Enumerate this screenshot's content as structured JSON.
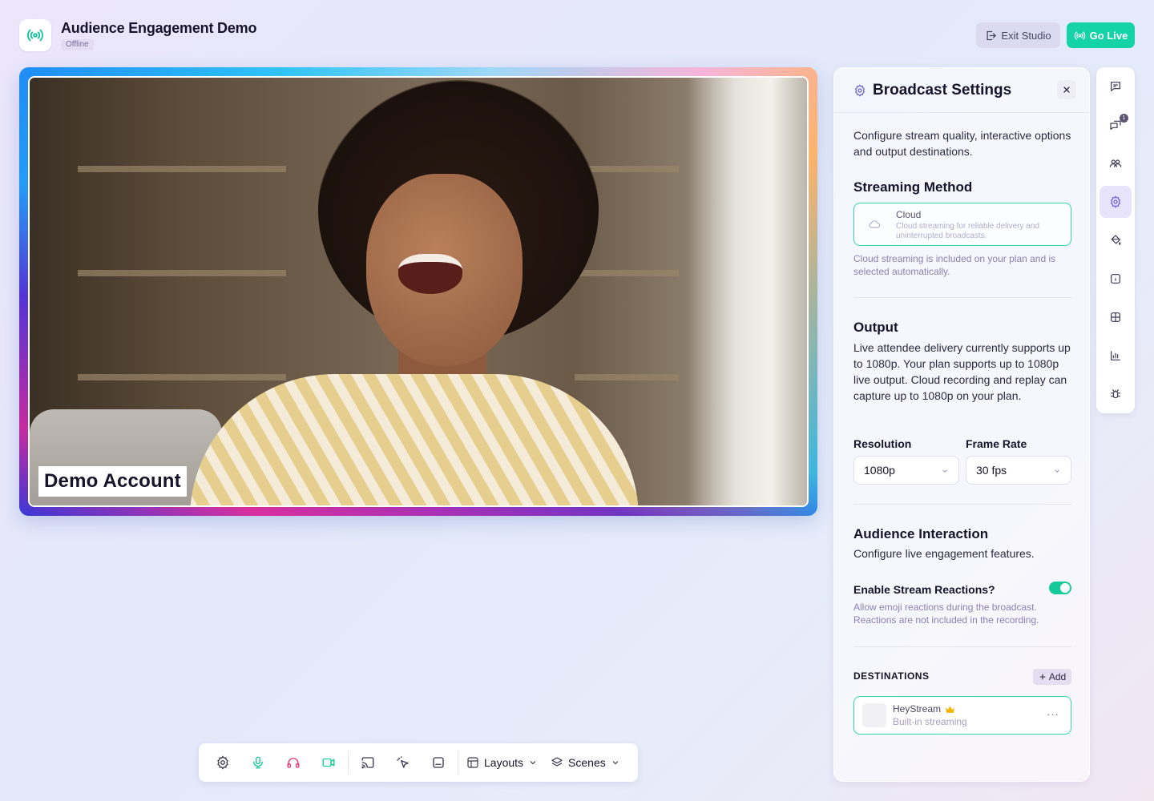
{
  "header": {
    "title": "Audience Engagement Demo",
    "status": "Offline",
    "exit_label": "Exit Studio",
    "golive_label": "Go Live"
  },
  "stage": {
    "name_tag": "Demo Account"
  },
  "toolbar": {
    "layouts_label": "Layouts",
    "scenes_label": "Scenes",
    "icons": [
      "gear-icon",
      "microphone-icon",
      "headphones-icon",
      "camera-icon",
      "cast-icon",
      "pointer-icon",
      "captions-icon"
    ]
  },
  "settings": {
    "title": "Broadcast Settings",
    "intro": "Configure stream quality, interactive options and output destinations.",
    "streaming_method": {
      "heading": "Streaming Method",
      "option_title": "Cloud",
      "option_desc": "Cloud streaming for reliable delivery and uninterrupted broadcasts.",
      "note": "Cloud streaming is included on your plan and is selected automatically."
    },
    "output": {
      "heading": "Output",
      "desc": "Live attendee delivery currently supports up to 1080p. Your plan supports up to 1080p live output. Cloud recording and replay can capture up to 1080p on your plan.",
      "resolution_label": "Resolution",
      "resolution_value": "1080p",
      "framerate_label": "Frame Rate",
      "framerate_value": "30 fps"
    },
    "interaction": {
      "heading": "Audience Interaction",
      "desc": "Configure live engagement features.",
      "reactions_label": "Enable Stream Reactions?",
      "reactions_enabled": true,
      "reactions_note": "Allow emoji reactions during the broadcast. Reactions are not included in the recording."
    },
    "destinations": {
      "heading": "DESTINATIONS",
      "add_label": "Add",
      "items": [
        {
          "name": "HeyStream",
          "sub": "Built-in streaming"
        }
      ]
    }
  },
  "rail": {
    "items": [
      "chat-icon",
      "qa-icon",
      "people-icon",
      "settings-icon",
      "paint-icon",
      "info-icon",
      "theme-icon",
      "analytics-icon",
      "bug-icon"
    ],
    "badge": "1"
  },
  "colors": {
    "accent": "#14d3a6",
    "brand_purple": "#6c5cd3"
  }
}
